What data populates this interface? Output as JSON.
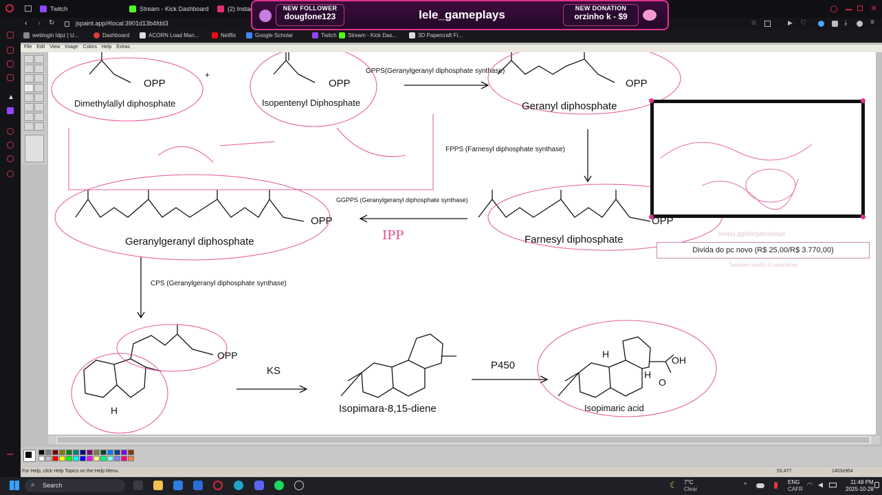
{
  "browser": {
    "tabs": [
      {
        "label": "Twitch",
        "icon": "twitch-icon",
        "color": "#9146ff"
      },
      {
        "label": "Stream - Kick Dashboard",
        "icon": "kick-icon",
        "color": "#53fc18"
      },
      {
        "label": "(2) Instag",
        "icon": "instagram-icon",
        "color": "#e1306c"
      }
    ],
    "url": "jspaint.app/#local:3901d13b4fdd3",
    "bookmarks": [
      {
        "label": "weblogin ldpz | U...",
        "icon": "page-icon",
        "color": "#888888"
      },
      {
        "label": "Dashboard",
        "icon": "dashboard-icon",
        "color": "#e23b3b"
      },
      {
        "label": "ACORN Load Man...",
        "icon": "acorn-icon",
        "color": "#e0e0e0"
      },
      {
        "label": "Netflix",
        "icon": "netflix-icon",
        "color": "#e50914"
      },
      {
        "label": "Google Scholar",
        "icon": "scholar-icon",
        "color": "#4285f4"
      },
      {
        "label": "Twitch",
        "icon": "twitch-icon",
        "color": "#9146ff"
      },
      {
        "label": "Stream - Kick Das...",
        "icon": "kick-icon",
        "color": "#53fc18"
      },
      {
        "label": "3D Papercraft Fi...",
        "icon": "papercraft-icon",
        "color": "#dddddd"
      }
    ]
  },
  "overlay": {
    "follower_heading": "NEW FOLLOWER",
    "follower_name": "dougfone123",
    "channel": "lele_gameplays",
    "donation_heading": "NEW DONATION",
    "donation_text": "orzinho k - $9",
    "accent": "#e0338e"
  },
  "paint": {
    "menu": [
      "File",
      "Edit",
      "View",
      "Image",
      "Colors",
      "Help",
      "Extras"
    ],
    "status_help": "For Help, click Help Topics on the Help Menu.",
    "status_coords": "53,477",
    "status_size": "1403x964",
    "palette": [
      "#000000",
      "#808080",
      "#800000",
      "#808000",
      "#008000",
      "#008080",
      "#000080",
      "#800080",
      "#808040",
      "#004040",
      "#0080ff",
      "#004080",
      "#8000ff",
      "#804000",
      "#ffffff",
      "#c0c0c0",
      "#ff0000",
      "#ffff00",
      "#00ff00",
      "#00ffff",
      "#0000ff",
      "#ff00ff",
      "#ffff80",
      "#00ff80",
      "#80ffff",
      "#8080ff",
      "#ff0080",
      "#ff8040"
    ]
  },
  "diagram": {
    "plus": "+",
    "dmapp_group": "OPP",
    "dmapp_name": "Dimethylallyl diphosphate",
    "ipp_group": "OPP",
    "ipp_name": "Isopentenyl Diphosphate",
    "gpps": "GPPS(Geranylgeranyl diphosphate synthase)",
    "gpp_group": "OPP",
    "gpp_name": "Geranyl diphosphate",
    "fpps": "FPPS (Farnesyl diphosphate synthase)",
    "fpp_group": "OPP",
    "fpp_name": "Farnesyl diphosphate",
    "ggpps": "GGPPS (Geranylgeranyl diphosphate synthase)",
    "ggpp_group": "OPP",
    "ggpp_name": "Geranylgeranyl diphosphate",
    "ipp_scribble": "IPP",
    "cps": "CPS (Geranylgeranyl diphosphate synthase)",
    "cpp_group": "OPP",
    "cpp_h": "H",
    "ks": "KS",
    "diene_name": "Isopimara-8,15-diene",
    "p450": "P450",
    "acid_oh": "OH",
    "acid_o": "O",
    "acid_h1": "H",
    "acid_h2": "H",
    "acid_name": "Isopimaric acid"
  },
  "stream_widget": {
    "goal_text": "Divida do pc novo (R$ 25,00/R$ 3.770,00)",
    "faint_url": "livepix.gg/lelegameplays",
    "faint_note": "Também aceito 4 caracteres"
  },
  "taskbar": {
    "search": "Search",
    "weather_temp": "7°C",
    "weather_desc": "Clear",
    "lang": "ENG",
    "region": "CAFR",
    "time": "11:48 PM",
    "date": "2025-10-28"
  }
}
